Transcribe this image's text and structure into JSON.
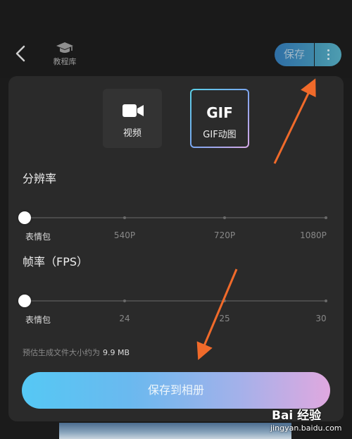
{
  "header": {
    "tutorial_label": "教程库",
    "save_label": "保存",
    "icons": {
      "back": "back-arrow-icon",
      "tutorial": "graduation-cap-icon",
      "more": "more-vertical-icon"
    }
  },
  "formats": [
    {
      "label": "视频",
      "icon": "video-camera-icon",
      "selected": false
    },
    {
      "label": "GIF动图",
      "icon_text": "GIF",
      "selected": true
    }
  ],
  "resolution": {
    "title": "分辨率",
    "ticks": [
      "表情包",
      "540P",
      "720P",
      "1080P"
    ],
    "selected_index": 0
  },
  "framerate": {
    "title": "帧率（FPS）",
    "ticks": [
      "表情包",
      "24",
      "25",
      "30"
    ],
    "selected_index": 0
  },
  "estimate": {
    "label": "预估生成文件大小约为",
    "size": "9.9 MB"
  },
  "cta_label": "保存到相册",
  "colors": {
    "accent_arrow": "#f06a2a",
    "cta_start": "#55c8f4",
    "cta_end": "#e0a8df"
  },
  "watermark": {
    "logo": "Bai 经验",
    "url": "jingyan.baidu.com"
  }
}
